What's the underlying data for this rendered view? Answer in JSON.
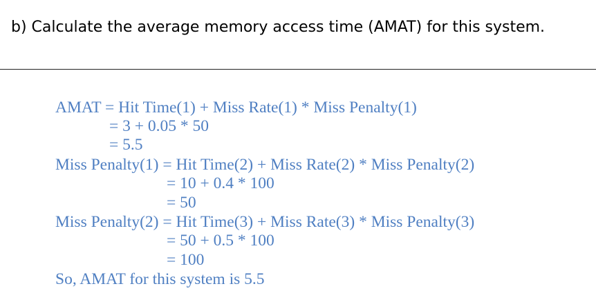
{
  "question": "b) Calculate the average memory access time (AMAT) for this system.",
  "answer_lines": [
    "AMAT = Hit Time(1) + Miss Rate(1) * Miss Penalty(1)",
    "= 3 + 0.05 * 50",
    "= 5.5",
    "Miss Penalty(1) = Hit Time(2) + Miss Rate(2) * Miss Penalty(2)",
    "= 10 + 0.4 * 100",
    "= 50",
    "Miss Penalty(2) = Hit Time(3) + Miss Rate(3) * Miss Penalty(3)",
    "= 50 + 0.5 * 100",
    "= 100",
    "So, AMAT for this system is 5.5"
  ],
  "colors": {
    "question_text": "#000000",
    "answer_text": "#4f7fc2",
    "rule": "#222222"
  }
}
